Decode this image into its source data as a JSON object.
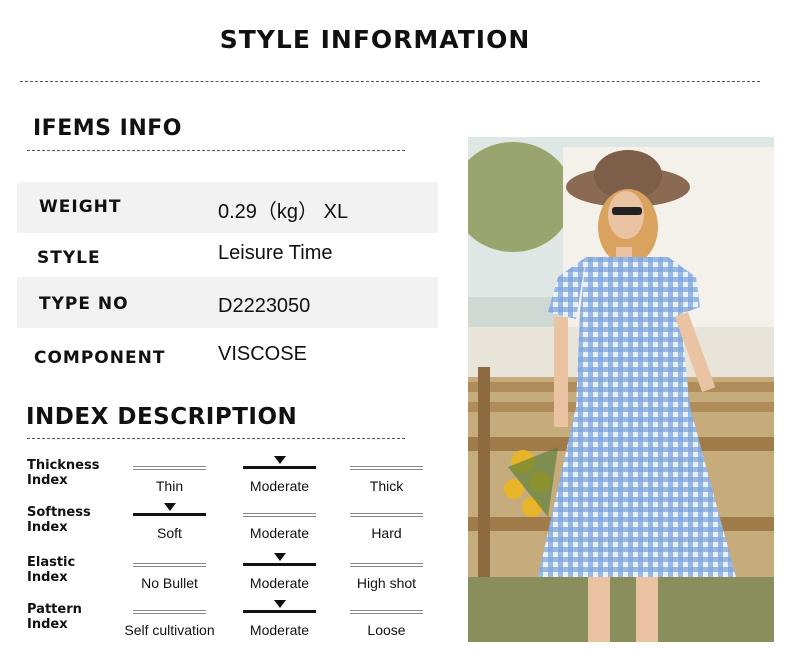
{
  "title": "STYLE INFORMATION",
  "items_info": {
    "heading": "IFEMS INFO",
    "rows": [
      {
        "label": "WEIGHT",
        "value": "0.29（kg） XL"
      },
      {
        "label": "STYLE",
        "value": "Leisure Time"
      },
      {
        "label": "TYPE NO",
        "value": "D2223050"
      },
      {
        "label": "COMPONENT",
        "value": "VISCOSE"
      }
    ]
  },
  "index": {
    "heading": "INDEX DESCRIPTION",
    "rows": [
      {
        "label": "Thickness\nIndex",
        "options": [
          "Thin",
          "Moderate",
          "Thick"
        ],
        "selected": 1
      },
      {
        "label": "Softness\nIndex",
        "options": [
          "Soft",
          "Moderate",
          "Hard"
        ],
        "selected": 0
      },
      {
        "label": "Elastic\nIndex",
        "options": [
          "No Bullet",
          "Moderate",
          "High shot"
        ],
        "selected": 1
      },
      {
        "label": "Pattern\nIndex",
        "options": [
          "Self cultivation",
          "Moderate",
          "Loose"
        ],
        "selected": 1
      }
    ]
  },
  "colors": {
    "accent": "#111111",
    "row_bg": "#f2f2f2",
    "dress": "#7fa7dc"
  },
  "image": {
    "icon": "product-photo-icon"
  }
}
